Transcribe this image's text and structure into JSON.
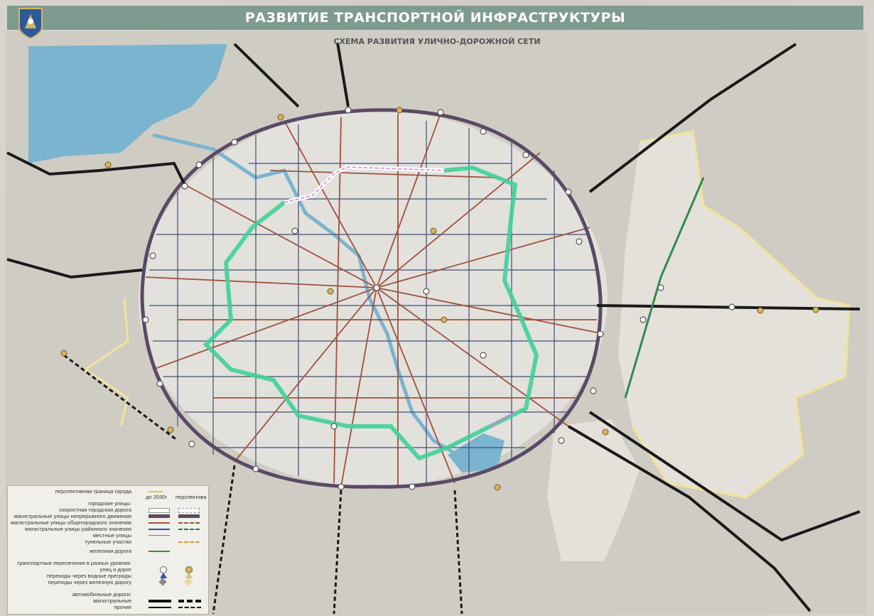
{
  "header": {
    "title": "РАЗВИТИЕ ТРАНСПОРТНОЙ ИНФРАСТРУКТУРЫ",
    "subtitle": "СХЕМА РАЗВИТИЯ УЛИЧНО-ДОРОЖНОЙ СЕТИ",
    "bar_color": "#7f9b90"
  },
  "legend": {
    "col_2030": "до 2030г",
    "col_perspective": "перспектива",
    "city_boundary": "перспективная граница города",
    "city_streets_header": "городские улицы:",
    "express_road": "скоростная городская дорога",
    "continuous_traffic": "магистральные улицы непрерывного движения",
    "citywide": "магистральные улицы общегородского значения",
    "district": "магистральные улицы районного значения",
    "local": "местные улицы",
    "tunnels": "тунельные участки",
    "railway": "железная дорога",
    "intersections_header": "транспортные пересечения в разных уровнях:",
    "streets_roads": "улиц и дорог",
    "water_crossings": "переходы через водные преграды",
    "rail_crossings": "переходы через железную дорогу",
    "highways_header": "автомобильные дороги:",
    "main_roads": "магистральные",
    "other_roads": "прочие"
  },
  "colors": {
    "express": "#ffffff",
    "continuous": "#5a4a66",
    "citywide": "#a0513d",
    "district": "#3d4f7a",
    "highlight_route": "#3fd19a",
    "tunnel": "#e07be0",
    "water": "#7bb4cf",
    "boundary": "#f2e39a"
  }
}
